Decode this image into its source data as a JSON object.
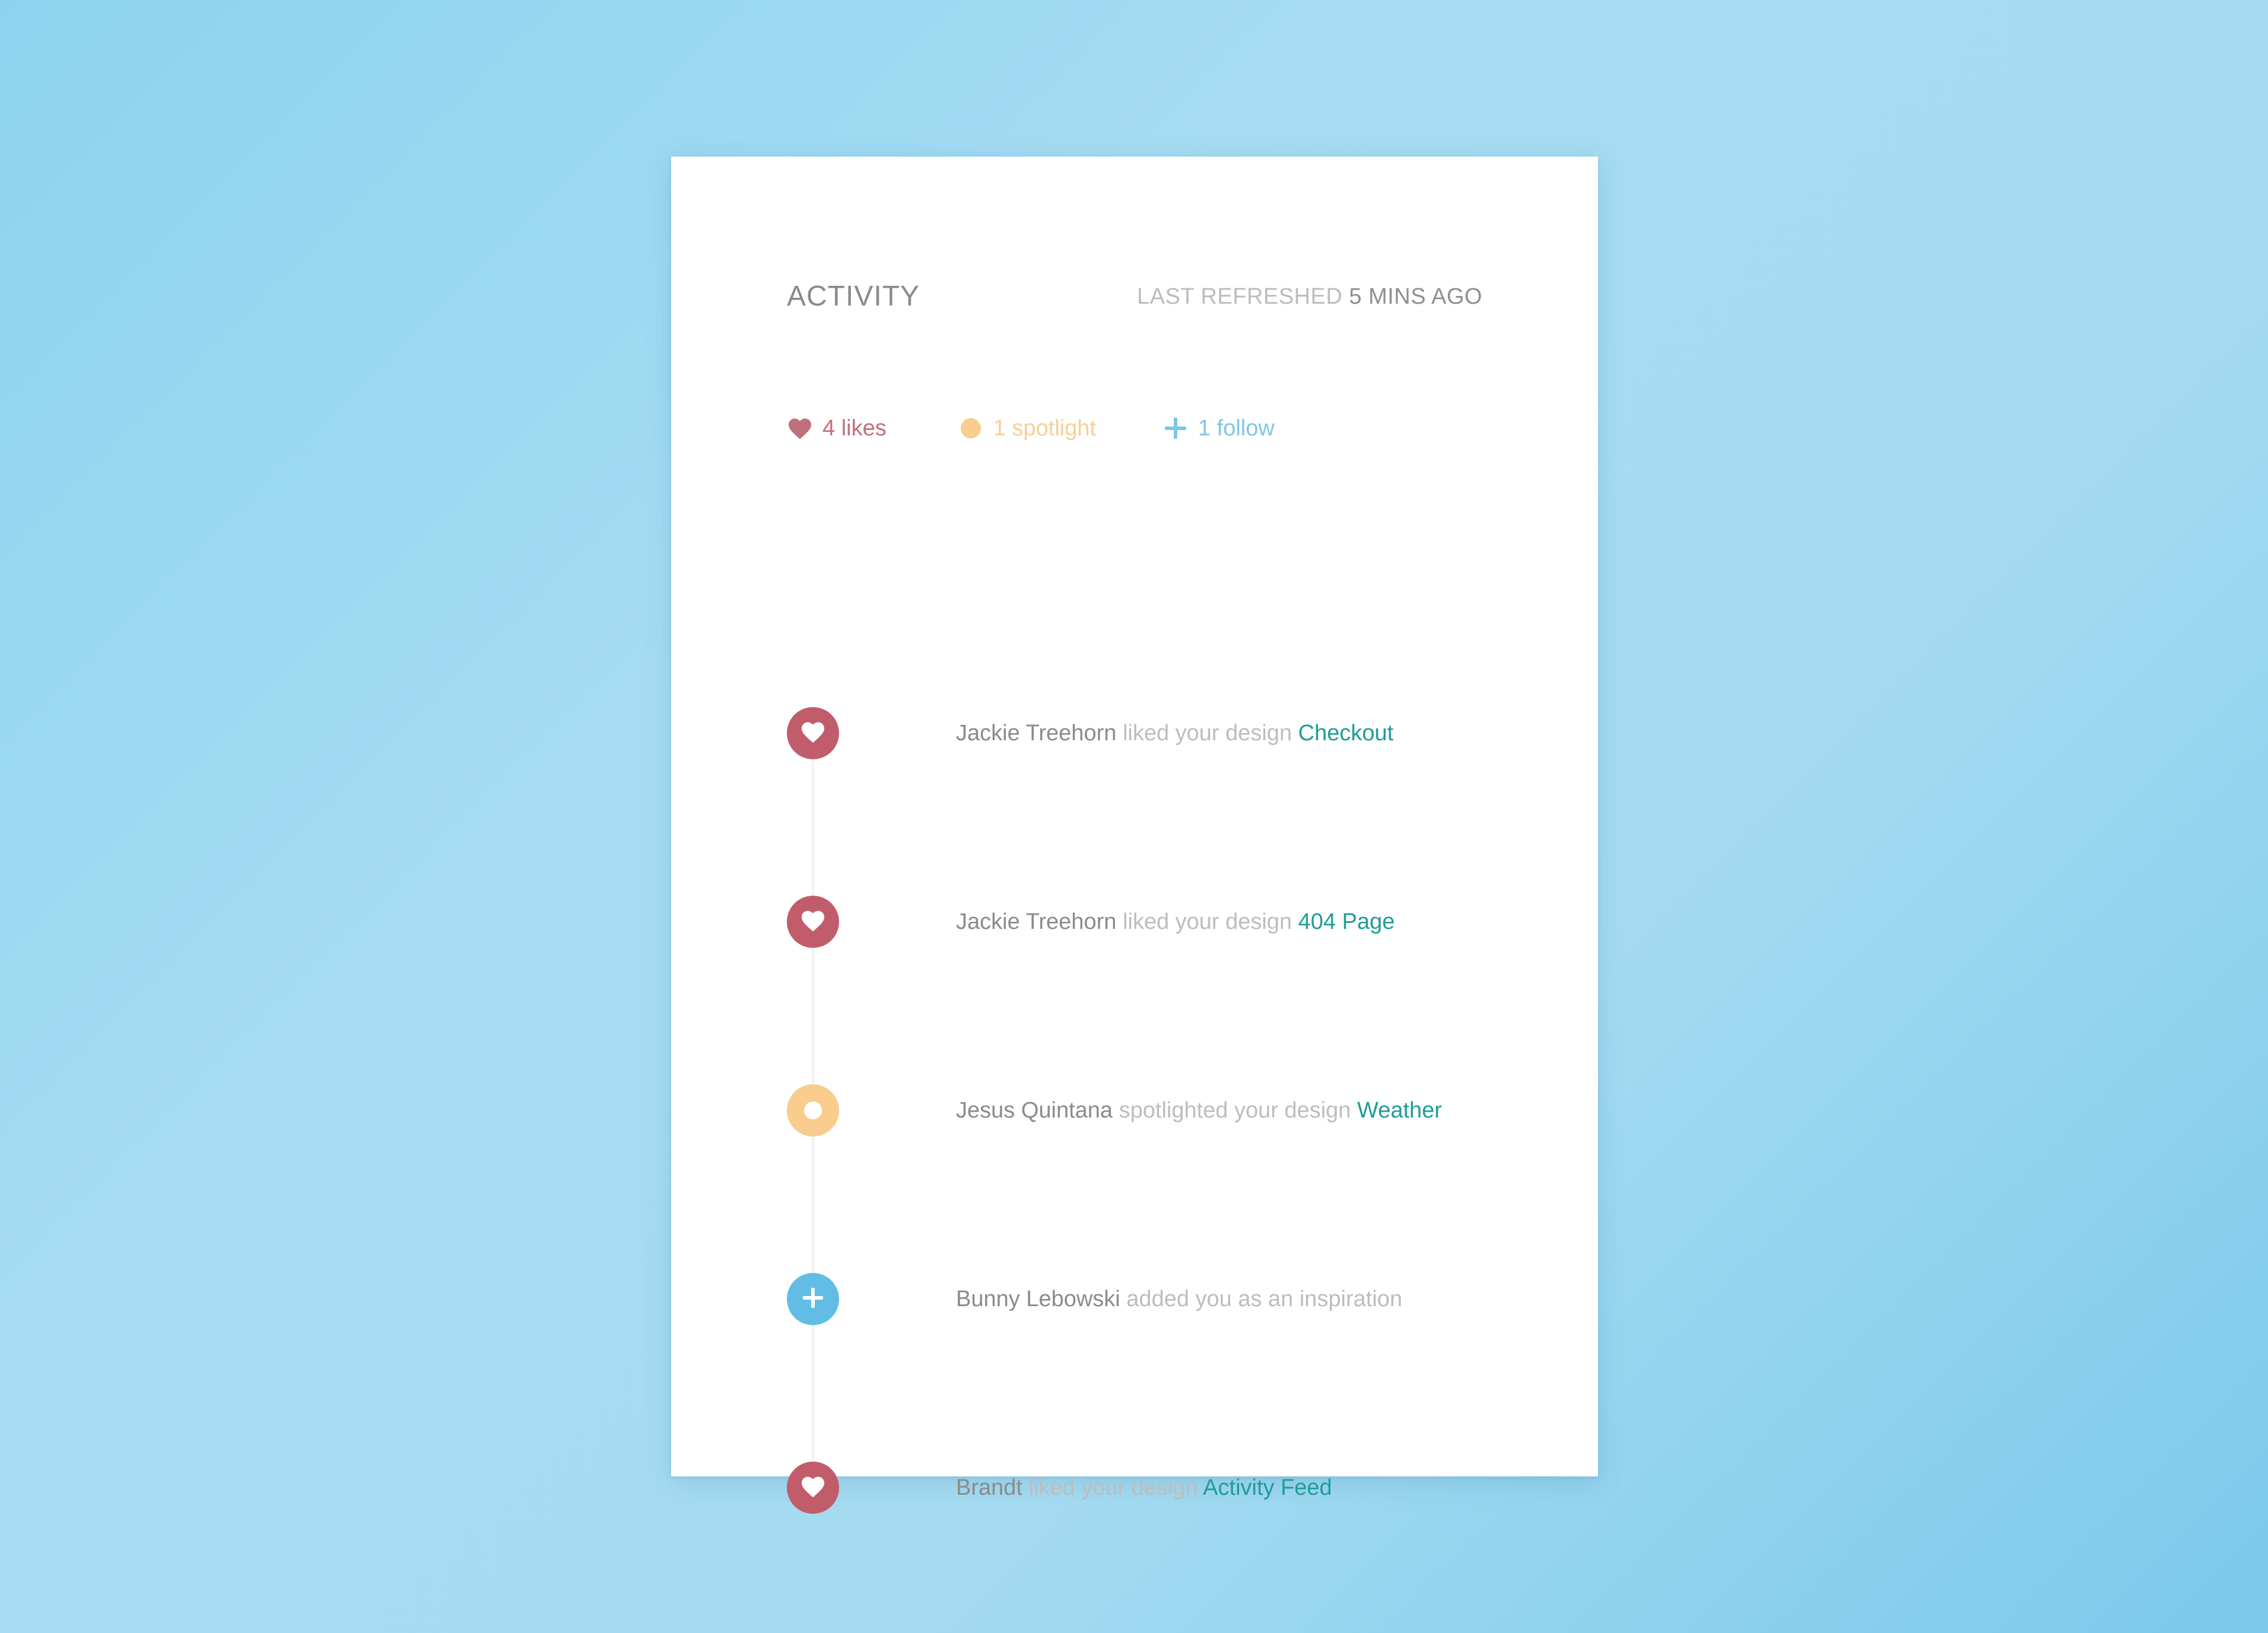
{
  "header": {
    "title": "ACTIVITY",
    "refresh_label": "LAST REFRESHED",
    "refresh_value": "5 MINS AGO"
  },
  "summary": {
    "likes": "4 likes",
    "spotlight": "1 spotlight",
    "follow": "1 follow"
  },
  "colors": {
    "like": "#c15d6b",
    "spotlight": "#f8cd8d",
    "follow": "#61bde3",
    "link": "#1f9d98"
  },
  "events": [
    {
      "icon": "heart-icon",
      "actor": "Jackie Treehorn",
      "verb": "liked your design",
      "target": "Checkout"
    },
    {
      "icon": "heart-icon",
      "actor": "Jackie Treehorn",
      "verb": "liked your design",
      "target": "404 Page"
    },
    {
      "icon": "spotlight-icon",
      "actor": "Jesus Quintana",
      "verb": "spotlighted your design",
      "target": "Weather"
    },
    {
      "icon": "plus-icon",
      "actor": "Bunny Lebowski",
      "verb": "added you as an inspiration",
      "target": ""
    },
    {
      "icon": "heart-icon",
      "actor": "Brandt",
      "verb": "liked your design",
      "target": "Activity Feed"
    }
  ]
}
